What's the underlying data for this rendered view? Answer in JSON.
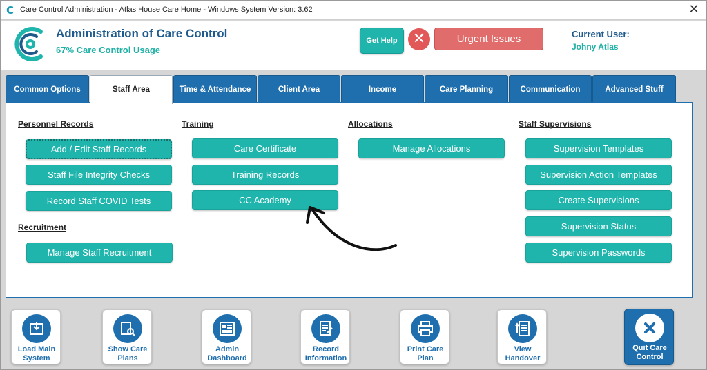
{
  "window": {
    "title": "Care Control Administration - Atlas House Care Home - Windows System Version: 3.62",
    "close_glyph": "✕"
  },
  "header": {
    "app_title": "Administration of Care Control",
    "usage": "67% Care Control Usage",
    "get_help_label": "Get Help",
    "urgent_label": "Urgent Issues",
    "current_user_label": "Current User:",
    "current_user_name": "Johny Atlas"
  },
  "tabs": [
    {
      "label": "Common Options"
    },
    {
      "label": "Staff Area",
      "active": true
    },
    {
      "label": "Time & Attendance"
    },
    {
      "label": "Client Area"
    },
    {
      "label": "Income"
    },
    {
      "label": "Care Planning"
    },
    {
      "label": "Communication"
    },
    {
      "label": "Advanced Stuff"
    }
  ],
  "staff_area": {
    "personnel": {
      "title": "Personnel Records",
      "buttons": [
        "Add / Edit Staff Records",
        "Staff File Integrity Checks",
        "Record Staff COVID Tests"
      ]
    },
    "recruitment": {
      "title": "Recruitment",
      "buttons": [
        "Manage Staff Recruitment"
      ]
    },
    "training": {
      "title": "Training",
      "buttons": [
        "Care Certificate",
        "Training Records",
        "CC Academy"
      ]
    },
    "allocations": {
      "title": "Allocations",
      "buttons": [
        "Manage Allocations"
      ]
    },
    "supervisions": {
      "title": "Staff Supervisions",
      "buttons": [
        "Supervision Templates",
        "Supervision Action Templates",
        "Create Supervisions",
        "Supervision Status",
        "Supervision Passwords"
      ]
    }
  },
  "bottom_bar": [
    {
      "label": "Load Main System",
      "icon": "load-system-icon"
    },
    {
      "label": "Show Care Plans",
      "icon": "care-plans-icon"
    },
    {
      "label": "Admin Dashboard",
      "icon": "dashboard-icon"
    },
    {
      "label": "Record Information",
      "icon": "record-icon"
    },
    {
      "label": "Print Care Plan",
      "icon": "printer-icon"
    },
    {
      "label": "View Handover",
      "icon": "handover-icon"
    },
    {
      "label": "Quit Care Control",
      "icon": "quit-icon"
    }
  ],
  "colors": {
    "teal": "#1fb5ad",
    "navy": "#1e5a8c",
    "tab_blue": "#1f6fae",
    "urgent_red": "#e06c6b"
  }
}
